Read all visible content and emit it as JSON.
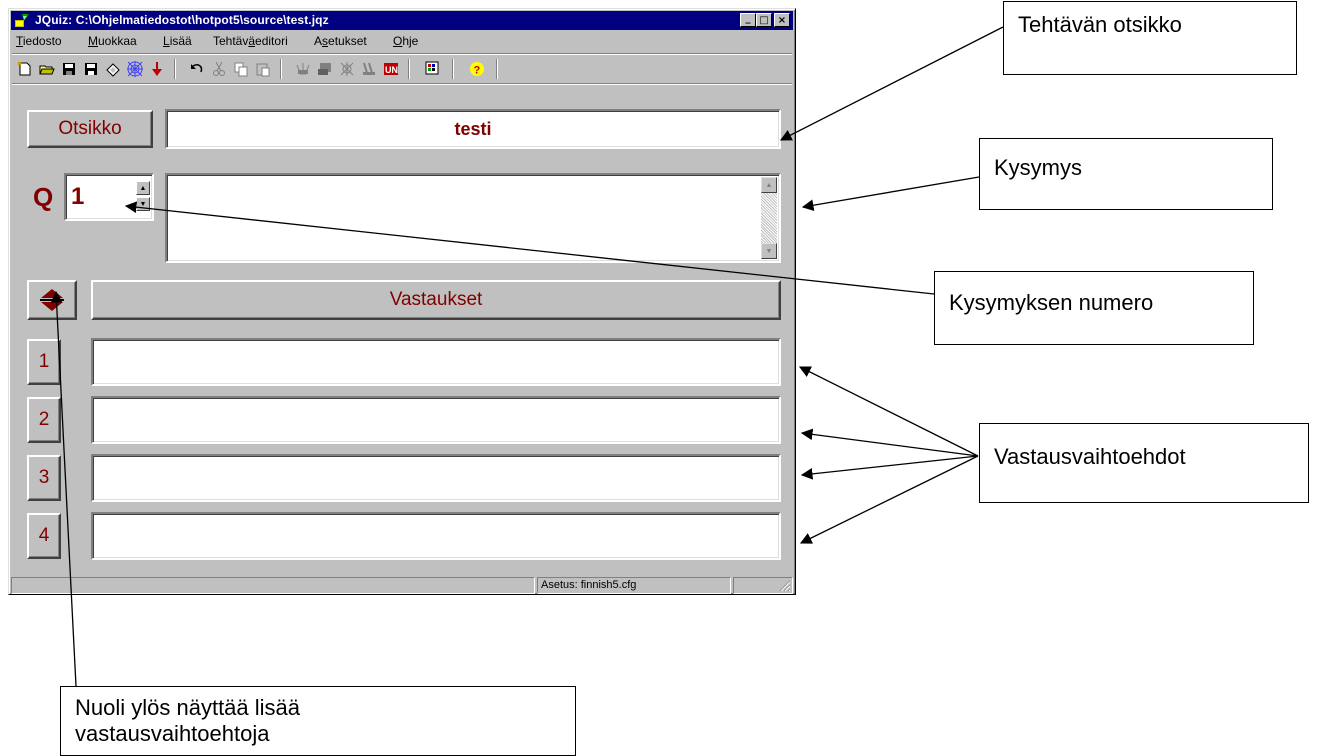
{
  "window": {
    "title": "JQuiz: C:\\Ohjelmatiedostot\\hotpot5\\source\\test.jqz",
    "controls": {
      "minimize": "_",
      "maximize": "□",
      "close": "×"
    }
  },
  "menu": {
    "items": [
      {
        "pre": "",
        "key": "T",
        "post": "iedosto"
      },
      {
        "pre": "",
        "key": "M",
        "post": "uokkaa"
      },
      {
        "pre": "",
        "key": "L",
        "post": "isää"
      },
      {
        "pre": "Tehtäv",
        "key": "ä",
        "post": "editori"
      },
      {
        "pre": "A",
        "key": "s",
        "post": "etukset"
      },
      {
        "pre": "",
        "key": "O",
        "post": "hje"
      }
    ]
  },
  "toolbar": {
    "icons": [
      "new-file-icon",
      "open-folder-icon",
      "save-icon",
      "save-as-icon",
      "eraser-icon",
      "web-icon",
      "export-arrow-icon",
      "undo-icon",
      "cut-icon",
      "copy-icon",
      "paste-icon",
      "web-publish-icon",
      "media-icon",
      "web-config-icon",
      "hotpot-icon",
      "unicode-icon",
      "config-palette-icon",
      "help-icon"
    ]
  },
  "form": {
    "title_button": "Otsikko",
    "title_value": "testi",
    "q_label": "Q",
    "question_number": "1",
    "question_text": "",
    "answers_header": "Vastaukset",
    "answers": [
      {
        "label": "1",
        "value": ""
      },
      {
        "label": "2",
        "value": ""
      },
      {
        "label": "3",
        "value": ""
      },
      {
        "label": "4",
        "value": ""
      }
    ]
  },
  "status": {
    "config": "Asetus: finnish5.cfg"
  },
  "annotations": {
    "title": "Tehtävän otsikko",
    "question": "Kysymys",
    "question_number": "Kysymyksen numero",
    "answer_options": "Vastausvaihtoehdot",
    "up_arrow_line1": "Nuoli ylös näyttää lisää",
    "up_arrow_line2": "vastausvaihtoehtoja"
  }
}
